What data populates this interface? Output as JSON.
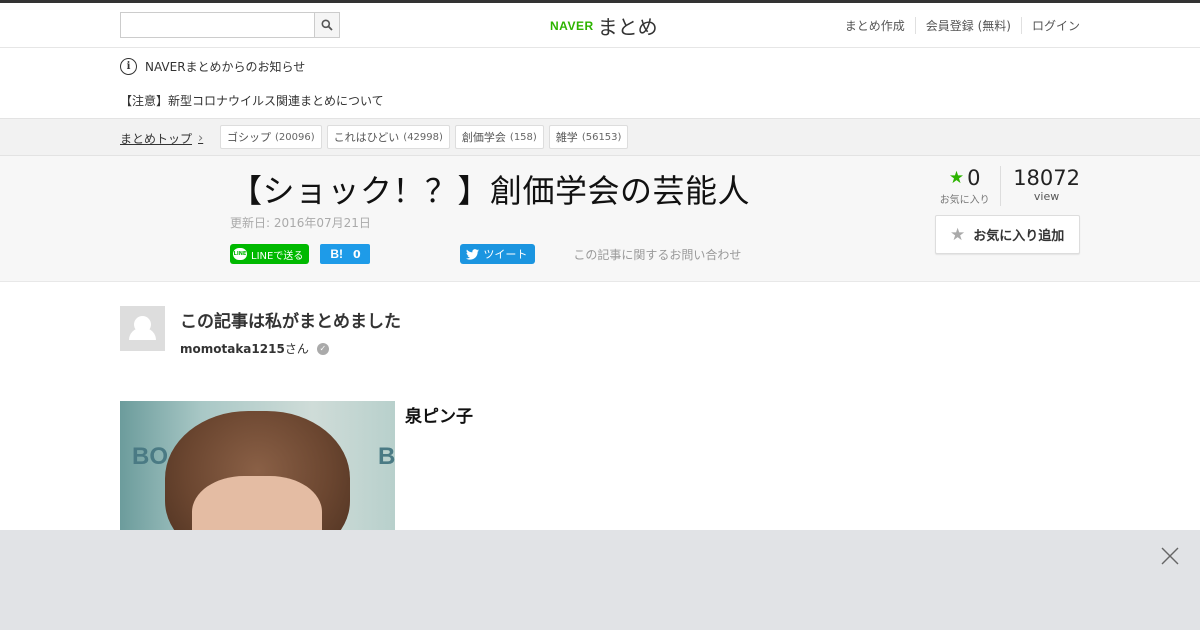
{
  "header": {
    "search_placeholder": "",
    "logo_naver": "NAVER",
    "logo_matome": "まとめ",
    "links": [
      "まとめ作成",
      "会員登録 (無料)",
      "ログイン"
    ]
  },
  "notice": {
    "heading": "NAVERまとめからのお知らせ",
    "link": "【注意】新型コロナウイルス関連まとめについて"
  },
  "breadcrumb": {
    "top": "まとめトップ",
    "tags": [
      {
        "name": "ゴシップ",
        "count": "(20096)"
      },
      {
        "name": "これはひどい",
        "count": "(42998)"
      },
      {
        "name": "創価学会",
        "count": "(158)"
      },
      {
        "name": "雑学",
        "count": "(56153)"
      }
    ]
  },
  "article": {
    "title": "【ショック！？】創価学会の芸能人",
    "updated": "更新日: 2016年07月21日",
    "share": {
      "line": "LINEで送る",
      "line_icon": "LINE",
      "hatena_b": "B!",
      "hatena_count": "0",
      "tweet": "ツイート",
      "contact": "この記事に関するお問い合わせ"
    },
    "stats": {
      "fav_count": "0",
      "fav_label": "お気に入り",
      "view_count": "18072",
      "view_label": "view"
    },
    "fav_add": "お気に入り追加"
  },
  "author": {
    "title": "この記事は私がまとめました",
    "id": "momotaka1215",
    "suffix": "さん"
  },
  "item": {
    "title": "泉ピン子",
    "photo_text_left": "BO",
    "photo_text_right": "B"
  },
  "colors": {
    "brand_green": "#2db400",
    "line_green": "#00b900",
    "hatena_blue": "#1e9be8",
    "twitter_blue": "#1b95e0"
  }
}
